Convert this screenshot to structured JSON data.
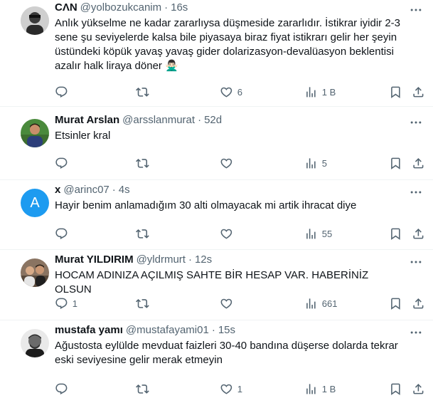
{
  "tweets": [
    {
      "name": "CΛN",
      "handle": "@yolbozukcanim",
      "time": "16s",
      "text": "Anlık yükselme ne kadar zararlıysa düşmeside zararlıdır. İstikrar iyidir 2-3 sene şu seviyelerde kalsa bile piyasaya biraz fiyat istikrarı gelir her şeyin üstündeki köpük yavaş yavaş gider dolarizasyon-devalüasyon beklentisi azalır halk liraya döner 🙅🏻‍♂️",
      "replies": "",
      "retweets": "",
      "likes": "6",
      "views": "1 B"
    },
    {
      "name": "Murat Arslan",
      "handle": "@arsslanmurat",
      "time": "52d",
      "text": "Etsinler kral",
      "replies": "",
      "retweets": "",
      "likes": "",
      "views": "5"
    },
    {
      "name": "x",
      "handle": "@arinc07",
      "time": "4s",
      "avatar_letter": "A",
      "text": "Hayir benim anlamadığım 30 alti olmayacak mi artik ihracat diye",
      "replies": "",
      "retweets": "",
      "likes": "",
      "views": "55"
    },
    {
      "name": "Murat YILDIRIM",
      "handle": "@yldrmurt",
      "time": "12s",
      "text": "HOCAM ADINIZA AÇILMIŞ SAHTE BİR HESAP VAR. HABERİNİZ OLSUN",
      "replies": "1",
      "retweets": "",
      "likes": "",
      "views": "661"
    },
    {
      "name": "mustafa yamı",
      "handle": "@mustafayami01",
      "time": "15s",
      "text": "Ağustosta eylülde mevduat faizleri 30-40 bandına düşerse dolarda tekrar eski seviyesine gelir merak etmeyin",
      "replies": "",
      "retweets": "",
      "likes": "1",
      "views": "1 B"
    }
  ],
  "colors": {
    "secondary_text": "#536471",
    "divider": "#eff3f4",
    "letter_avatar_bg": "#1d9bf0"
  },
  "icons": [
    "reply-icon",
    "retweet-icon",
    "like-icon",
    "views-icon",
    "bookmark-icon",
    "share-icon",
    "more-icon"
  ]
}
